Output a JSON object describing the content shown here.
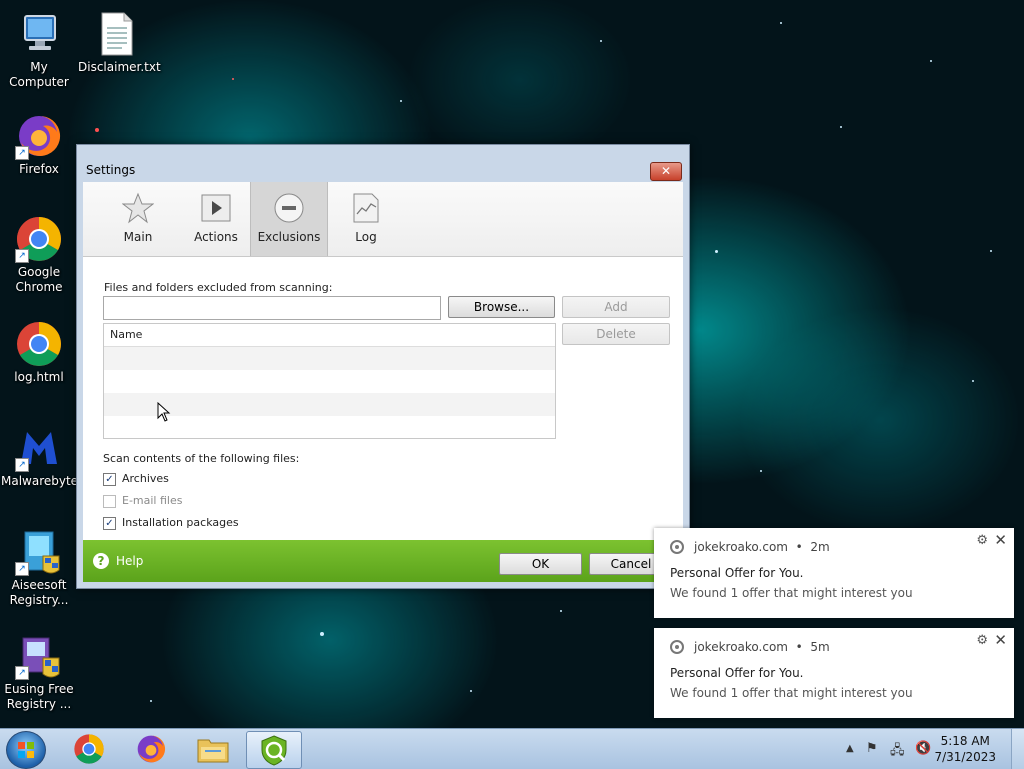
{
  "desktop": {
    "icons": [
      {
        "label": "My Computer",
        "icon": "computer-icon"
      },
      {
        "label": "Disclaimer.txt",
        "icon": "text-file-icon"
      },
      {
        "label": "Firefox",
        "icon": "firefox-icon"
      },
      {
        "label": "Google Chrome",
        "icon": "chrome-icon"
      },
      {
        "label": "log.html",
        "icon": "chrome-icon"
      },
      {
        "label": "Malwarebytes",
        "icon": "malwarebytes-icon"
      },
      {
        "label": "Aiseesoft Registry...",
        "icon": "installer-icon"
      },
      {
        "label": "Eusing Free Registry ...",
        "icon": "installer-icon"
      }
    ]
  },
  "window": {
    "title": "Settings",
    "close_label": "✕",
    "tabs": [
      {
        "label": "Main",
        "icon": "star-icon"
      },
      {
        "label": "Actions",
        "icon": "play-icon"
      },
      {
        "label": "Exclusions",
        "icon": "minus-circle-icon"
      },
      {
        "label": "Log",
        "icon": "log-chart-icon"
      }
    ],
    "active_tab": "Exclusions",
    "exclusions": {
      "section_label": "Files and folders excluded from scanning:",
      "path_value": "",
      "browse_label": "Browse...",
      "add_label": "Add",
      "delete_label": "Delete",
      "list_header": "Name",
      "rows": [
        "",
        "",
        "",
        ""
      ]
    },
    "scan": {
      "section_label": "Scan contents of the following files:",
      "options": [
        {
          "label": "Archives",
          "checked": true,
          "enabled": true
        },
        {
          "label": "E-mail files",
          "checked": false,
          "enabled": false
        },
        {
          "label": "Installation packages",
          "checked": true,
          "enabled": true
        }
      ]
    },
    "footer": {
      "help_label": "Help",
      "ok_label": "OK",
      "cancel_label": "Cancel",
      "accent_color": "#6ab424"
    }
  },
  "notifications": [
    {
      "site": "jokekroako.com",
      "time": "2m",
      "title": "Personal Offer for You.",
      "body": "We found 1 offer that might interest you"
    },
    {
      "site": "jokekroako.com",
      "time": "5m",
      "title": "Personal Offer for You.",
      "body": "We found 1 offer that might interest you"
    }
  ],
  "taskbar": {
    "pinned": [
      "chrome-icon",
      "firefox-icon",
      "file-explorer-icon",
      "antivirus-app-icon"
    ],
    "clock_time": "5:18 AM",
    "clock_date": "7/31/2023"
  }
}
